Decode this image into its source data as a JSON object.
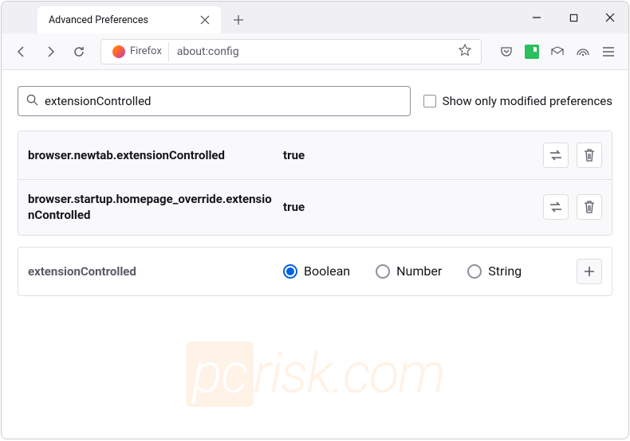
{
  "tab": {
    "title": "Advanced Preferences"
  },
  "url_bar": {
    "identity_label": "Firefox",
    "url": "about:config"
  },
  "search": {
    "value": "extensionControlled",
    "modified_only_label": "Show only modified preferences"
  },
  "prefs": [
    {
      "name": "browser.newtab.extensionControlled",
      "value": "true"
    },
    {
      "name": "browser.startup.homepage_override.extensionControlled",
      "value": "true"
    }
  ],
  "new_pref": {
    "name": "extensionControlled",
    "types": [
      "Boolean",
      "Number",
      "String"
    ],
    "selected": "Boolean"
  }
}
